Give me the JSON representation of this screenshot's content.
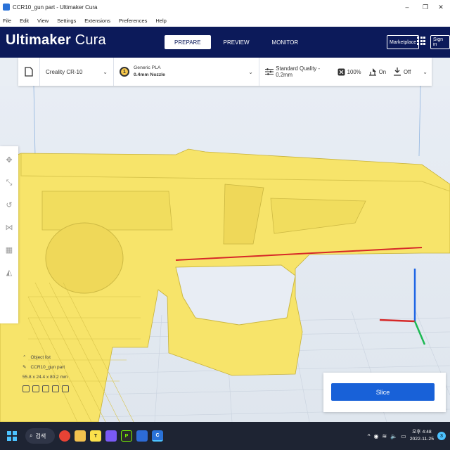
{
  "window": {
    "title": "CCR10_gun part - Ultimaker Cura",
    "minimize": "–",
    "maximize": "❐",
    "close": "✕"
  },
  "menu": [
    "File",
    "Edit",
    "View",
    "Settings",
    "Extensions",
    "Preferences",
    "Help"
  ],
  "header": {
    "logo_bold": "Ultimaker",
    "logo_light": "Cura",
    "tabs": [
      "PREPARE",
      "PREVIEW",
      "MONITOR"
    ],
    "active_tab": "PREPARE",
    "marketplace": "Marketplace",
    "sign_in": "Sign in"
  },
  "toolbar": {
    "printer": "Creality CR-10",
    "nozzle_badge": "1",
    "material_brand": "Generic PLA",
    "nozzle": "0.4mm Nozzle",
    "quality": "Standard Quality - 0.2mm",
    "infill": "100%",
    "support": "On",
    "adhesion": "Off"
  },
  "object_list": {
    "heading": "Object list",
    "object_name": "CCR10_gun part",
    "dimensions": "55.8 x 24.4 x 80.2 mm"
  },
  "slice": {
    "label": "Slice"
  },
  "taskbar": {
    "search_label": "검색",
    "time": "오후 4:48",
    "date": "2022-11-25",
    "notif": "3"
  },
  "colors": {
    "header_bg": "#0c1a5a",
    "accent": "#1861d8",
    "model": "#f7e46a"
  },
  "icons": [
    "folder-icon",
    "nozzle-icon",
    "settings-sliders-icon",
    "infill-icon",
    "support-icon",
    "adhesion-icon",
    "grid-apps-icon",
    "move-icon",
    "scale-icon",
    "rotate-icon",
    "mirror-icon",
    "per-model-settings-icon",
    "support-blocker-icon",
    "windows-start-icon",
    "search-icon"
  ]
}
